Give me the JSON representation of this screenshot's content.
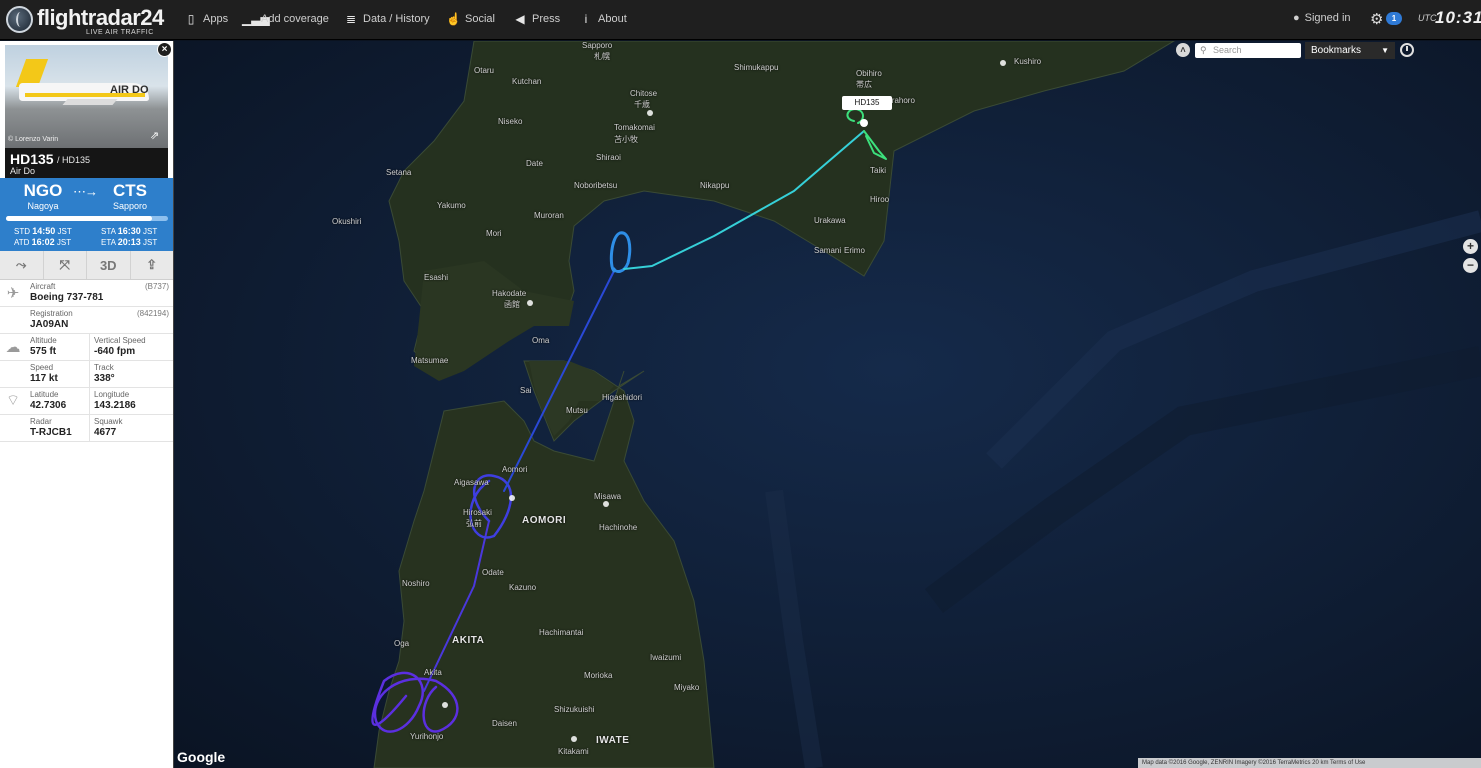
{
  "topbar": {
    "brand": "flightradar",
    "brand_num": "24",
    "tagline": "LIVE AIR TRAFFIC",
    "nav": [
      {
        "label": "Apps",
        "icon": "phone-icon"
      },
      {
        "label": "Add coverage",
        "icon": "signal-bars-icon"
      },
      {
        "label": "Data / History",
        "icon": "database-icon"
      },
      {
        "label": "Social",
        "icon": "thumbs-up-icon"
      },
      {
        "label": "Press",
        "icon": "megaphone-icon"
      },
      {
        "label": "About",
        "icon": "info-icon"
      }
    ],
    "signed_in": "Signed in",
    "notification_count": "1",
    "utc_label": "UTC",
    "clock": "10:31"
  },
  "panel": {
    "photo_credit": "© Lorenzo Varin",
    "photo_brand": "AIR DO",
    "callsign": "HD135",
    "flight_number": "/ HD135",
    "airline": "Air Do",
    "origin": {
      "code": "NGO",
      "city": "Nagoya"
    },
    "destination": {
      "code": "CTS",
      "city": "Sapporo"
    },
    "progress": 0.9,
    "times": {
      "std_label": "STD",
      "std": "14:50",
      "std_tz": "JST",
      "atd_label": "ATD",
      "atd": "16:02",
      "atd_tz": "JST",
      "sta_label": "STA",
      "sta": "16:30",
      "sta_tz": "JST",
      "eta_label": "ETA",
      "eta": "20:13",
      "eta_tz": "JST"
    },
    "tools": {
      "route_icon": "route-icon",
      "expand_icon": "expand-icon",
      "view3d": "3D",
      "share_icon": "share-icon"
    },
    "details": {
      "aircraft_label": "Aircraft",
      "aircraft": "Boeing 737-781",
      "aircraft_code": "(B737)",
      "registration_label": "Registration",
      "registration": "JA09AN",
      "registration_code": "(842194)",
      "altitude_label": "Altitude",
      "altitude": "575 ft",
      "vspeed_label": "Vertical Speed",
      "vspeed": "-640 fpm",
      "speed_label": "Speed",
      "speed": "117 kt",
      "track_label": "Track",
      "track": "338°",
      "lat_label": "Latitude",
      "lat": "42.7306",
      "lon_label": "Longitude",
      "lon": "143.2186",
      "radar_label": "Radar",
      "radar": "T-RJCB1",
      "squawk_label": "Squawk",
      "squawk": "4677"
    }
  },
  "map": {
    "search_placeholder": "Search",
    "bookmarks_label": "Bookmarks",
    "callsign_tag": "HD135",
    "google": "Google",
    "attribution": "Map data ©2016 Google, ZENRIN Imagery ©2016 TerraMetrics   20 km   Terms of Use",
    "labels": [
      "Sapporo",
      "札幌",
      "Chitose",
      "千歳",
      "Tomakomai",
      "苫小牧",
      "Obihiro",
      "帯広",
      "Kushiro",
      "Shimukappu",
      "Urahoro",
      "Otaru",
      "Kutchan",
      "Niseko",
      "Date",
      "Noboribetsu",
      "Muroran",
      "Setana",
      "Yakumo",
      "Mori",
      "Okushiri",
      "Esashi",
      "Hakodate",
      "函館",
      "Matsumae",
      "Oma",
      "Sai",
      "Mutsu",
      "Higashidori",
      "Aomori",
      "AOMORI",
      "Aigasawa",
      "Hirosaki",
      "弘前",
      "Misawa",
      "Hachinohe",
      "Noshiro",
      "Odate",
      "Kazuno",
      "AKITA",
      "Oga",
      "Akita",
      "Hachimantai",
      "Morioka",
      "Miyako",
      "Daisen",
      "Yurihonjo",
      "Kitakami",
      "IWATE",
      "Shizukuishi",
      "Iwaizumi",
      "Urakawa",
      "Samani",
      "Erimo",
      "Hiroo",
      "Taiki",
      "Shiraoi",
      "Nikappu"
    ]
  },
  "colors": {
    "route_blue": "#2f7fcb",
    "track_early": "#5b2fe0",
    "track_mid": "#2a49d6",
    "track_late": "#36d0d8",
    "track_end": "#3ce07c"
  }
}
